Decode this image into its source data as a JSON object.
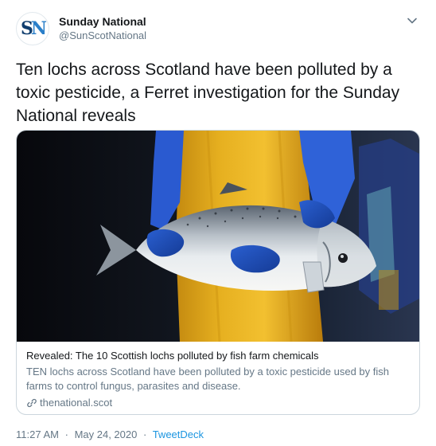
{
  "account": {
    "display_name": "Sunday National",
    "handle": "@SunScotNational",
    "avatar_initials": "SN"
  },
  "tweet": {
    "text": "Ten lochs across Scotland have been polluted by a toxic pesticide, a Ferret investigation for the Sunday National reveals"
  },
  "card": {
    "title": "Revealed: The 10 Scottish lochs polluted by fish farm chemicals",
    "description": "TEN lochs across Scotland have been polluted by a toxic pesticide used by fish farms to control fungus, parasites and disease.",
    "domain": "thenational.scot"
  },
  "meta": {
    "time": "11:27 AM",
    "separator": "·",
    "date": "May 24, 2020",
    "source": "TweetDeck"
  },
  "colors": {
    "text": "#14171a",
    "secondary": "#657786",
    "link": "#1b95e0",
    "border": "#ccd6dd",
    "brand_dark": "#0f3d6e",
    "brand_light": "#2a7fc9"
  },
  "icons": {
    "caret": "chevron-down-icon",
    "link": "link-icon"
  }
}
